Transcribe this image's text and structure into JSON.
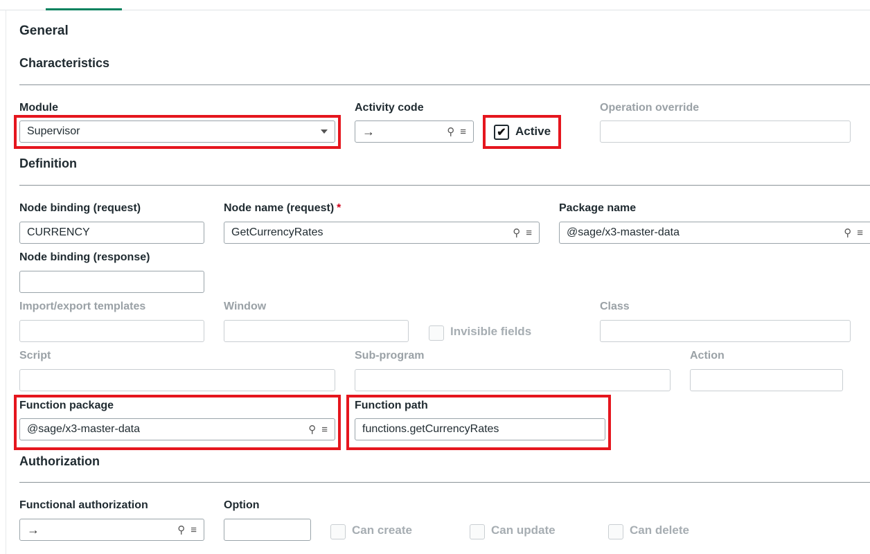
{
  "sections": {
    "general": "General",
    "characteristics": "Characteristics",
    "definition": "Definition",
    "authorization": "Authorization"
  },
  "characteristics": {
    "module_label": "Module",
    "module_value": "Supervisor",
    "activity_code_label": "Activity code",
    "activity_code_arrow": "→",
    "active_label": "Active",
    "active_checked": true,
    "operation_override_label": "Operation override"
  },
  "definition": {
    "node_binding_request_label": "Node binding (request)",
    "node_binding_request_value": "CURRENCY",
    "node_name_request_label": "Node name (request)",
    "required_mark": "*",
    "node_name_request_value": "GetCurrencyRates",
    "package_name_label": "Package name",
    "package_name_value": "@sage/x3-master-data",
    "node_binding_response_label": "Node binding (response)",
    "import_export_label": "Import/export templates",
    "window_label": "Window",
    "invisible_fields_label": "Invisible fields",
    "class_label": "Class",
    "script_label": "Script",
    "subprogram_label": "Sub-program",
    "action_label": "Action",
    "function_package_label": "Function package",
    "function_package_value": "@sage/x3-master-data",
    "function_path_label": "Function path",
    "function_path_value": "functions.getCurrencyRates"
  },
  "authorization": {
    "functional_authorization_label": "Functional authorization",
    "functional_authorization_arrow": "→",
    "option_label": "Option",
    "can_create_label": "Can create",
    "can_update_label": "Can update",
    "can_delete_label": "Can delete"
  },
  "icons": {
    "search": "⚲",
    "list": "≡",
    "check": "✔"
  },
  "colors": {
    "accent": "#00815d",
    "highlight": "#e5161e",
    "required": "#d0021b"
  }
}
